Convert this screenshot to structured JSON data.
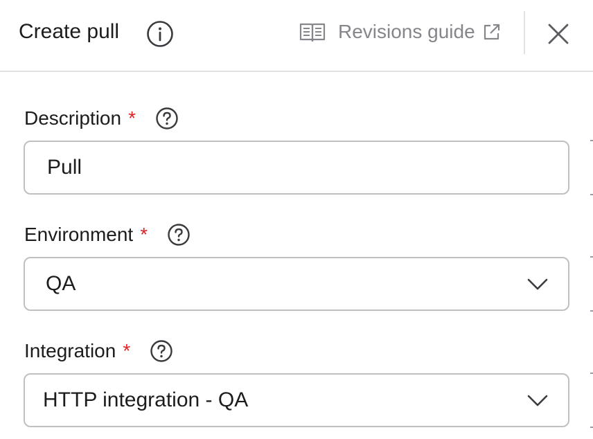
{
  "header": {
    "title": "Create pull",
    "guide_link_label": "Revisions guide",
    "icons": {
      "info": "info-circle-icon",
      "guide": "book-open-icon",
      "external": "external-link-icon",
      "close": "close-icon"
    }
  },
  "form": {
    "required_marker": "*",
    "description": {
      "label": "Description",
      "value": "Pull"
    },
    "environment": {
      "label": "Environment",
      "selected": "QA"
    },
    "integration": {
      "label": "Integration",
      "selected": "HTTP integration - QA"
    }
  },
  "colors": {
    "required": "#e02424",
    "muted_text": "#85858c",
    "border": "#bfbfc4",
    "divider": "#e1e1e4"
  }
}
